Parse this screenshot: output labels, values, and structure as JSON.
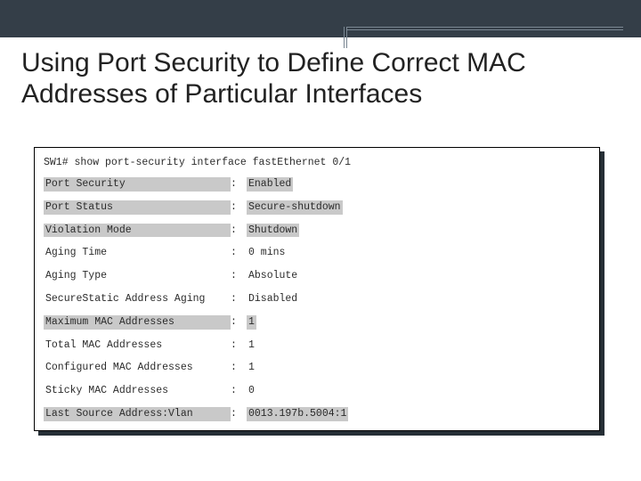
{
  "title": "Using Port Security to Define Correct MAC Addresses of Particular Interfaces",
  "cli": {
    "prompt": "SW1#",
    "command": "show port-security interface fastEthernet 0/1"
  },
  "rows": [
    {
      "label": "Port Security",
      "value": "Enabled",
      "hl_label": true,
      "hl_value": true
    },
    {
      "label": "Port Status",
      "value": "Secure-shutdown",
      "hl_label": true,
      "hl_value": true
    },
    {
      "label": "Violation Mode",
      "value": "Shutdown",
      "hl_label": true,
      "hl_value": true
    },
    {
      "label": "Aging Time",
      "value": "0 mins",
      "hl_label": false,
      "hl_value": false
    },
    {
      "label": "Aging Type",
      "value": "Absolute",
      "hl_label": false,
      "hl_value": false
    },
    {
      "label": "SecureStatic Address Aging",
      "value": "Disabled",
      "hl_label": false,
      "hl_value": false
    },
    {
      "label": "Maximum MAC Addresses",
      "value": "1",
      "hl_label": true,
      "hl_value": true
    },
    {
      "label": "Total MAC Addresses",
      "value": "1",
      "hl_label": false,
      "hl_value": false
    },
    {
      "label": "Configured MAC Addresses",
      "value": "1",
      "hl_label": false,
      "hl_value": false
    },
    {
      "label": "Sticky MAC Addresses",
      "value": "0",
      "hl_label": false,
      "hl_value": false
    },
    {
      "label": "Last Source Address:Vlan",
      "value": "0013.197b.5004:1",
      "hl_label": true,
      "hl_value": true
    }
  ]
}
